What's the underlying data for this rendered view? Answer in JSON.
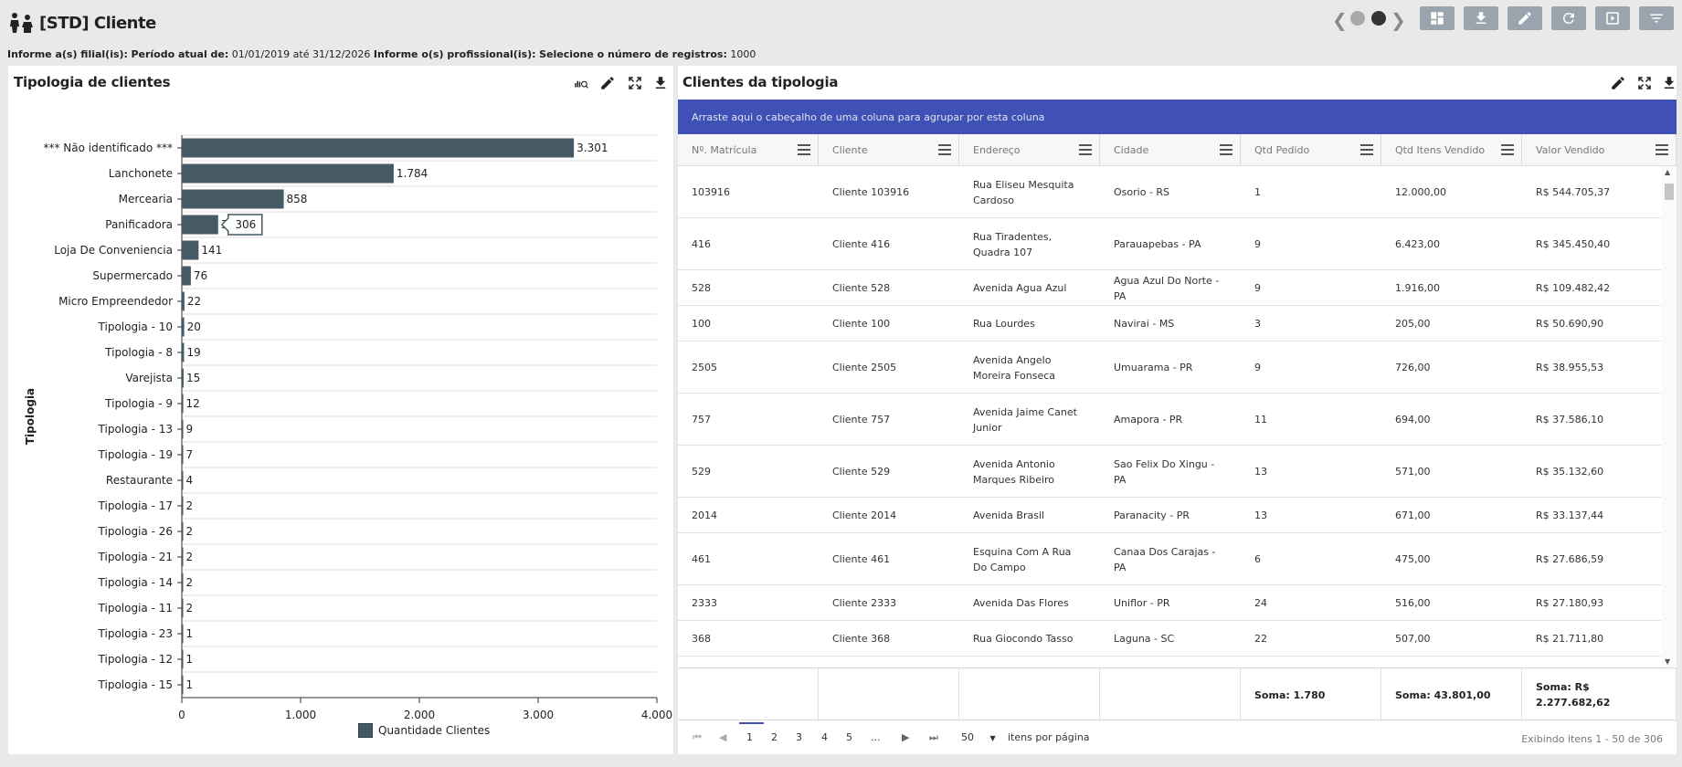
{
  "header": {
    "title": "[STD] Cliente"
  },
  "filters": {
    "branch_label": "Informe a(s) filial(is):",
    "period_label": "Período atual de:",
    "period_value": "01/01/2019 até 31/12/2026",
    "prof_label": "Informe o(s) profissional(is):",
    "records_label": "Selecione o número de registros:",
    "records_value": "1000"
  },
  "left_panel": {
    "title": "Tipologia de clientes",
    "legend_label": "Quantidade Clientes",
    "tooltip_value": "306"
  },
  "chart_data": {
    "type": "bar",
    "orientation": "horizontal",
    "ylabel": "Tipologia",
    "xlim": [
      0,
      4000
    ],
    "x_ticks": [
      "0",
      "1.000",
      "2.000",
      "3.000",
      "4.000"
    ],
    "x_tick_values": [
      0,
      1000,
      2000,
      3000,
      4000
    ],
    "categories": [
      "*** Não identificado ***",
      "Lanchonete",
      "Mercearia",
      "Panificadora",
      "Loja De Conveniencia",
      "Supermercado",
      "Micro Empreendedor",
      "Tipologia - 10",
      "Tipologia - 8",
      "Varejista",
      "Tipologia - 9",
      "Tipologia - 13",
      "Tipologia - 19",
      "Restaurante",
      "Tipologia - 17",
      "Tipologia - 26",
      "Tipologia - 21",
      "Tipologia - 14",
      "Tipologia - 11",
      "Tipologia - 23",
      "Tipologia - 12",
      "Tipologia - 15"
    ],
    "values": [
      3301,
      1784,
      858,
      306,
      141,
      76,
      22,
      20,
      19,
      15,
      12,
      9,
      7,
      4,
      2,
      2,
      2,
      2,
      2,
      1,
      1,
      1
    ],
    "labels": [
      "3.301",
      "1.784",
      "858",
      "306",
      "141",
      "76",
      "22",
      "20",
      "19",
      "15",
      "12",
      "9",
      "7",
      "4",
      "2",
      "2",
      "2",
      "2",
      "2",
      "1",
      "1",
      "1"
    ],
    "series": [
      {
        "name": "Quantidade Clientes",
        "color": "#455a64"
      }
    ],
    "grid": true,
    "legend": "bottom-center"
  },
  "right_panel": {
    "title": "Clientes da tipologia",
    "group_hint": "Arraste aqui o cabeçalho de uma coluna para agrupar por esta coluna",
    "columns": [
      "Nº. Matrícula",
      "Cliente",
      "Endereço",
      "Cidade",
      "Qtd Pedido",
      "Qtd Itens Vendido",
      "Valor Vendido"
    ],
    "rows": [
      [
        "103916",
        "Cliente 103916",
        "Rua Eliseu Mesquita Cardoso",
        "Osorio - RS",
        "1",
        "12.000,00",
        "R$ 544.705,37"
      ],
      [
        "416",
        "Cliente 416",
        "Rua Tiradentes, Quadra 107",
        "Parauapebas - PA",
        "9",
        "6.423,00",
        "R$ 345.450,40"
      ],
      [
        "528",
        "Cliente 528",
        "Avenida Agua Azul",
        "Agua Azul Do Norte - PA",
        "9",
        "1.916,00",
        "R$ 109.482,42"
      ],
      [
        "100",
        "Cliente 100",
        "Rua Lourdes",
        "Navirai - MS",
        "3",
        "205,00",
        "R$ 50.690,90"
      ],
      [
        "2505",
        "Cliente 2505",
        "Avenida Angelo Moreira Fonseca",
        "Umuarama - PR",
        "9",
        "726,00",
        "R$ 38.955,53"
      ],
      [
        "757",
        "Cliente 757",
        "Avenida Jaime Canet Junior",
        "Amapora - PR",
        "11",
        "694,00",
        "R$ 37.586,10"
      ],
      [
        "529",
        "Cliente 529",
        "Avenida Antonio Marques Ribeiro",
        "Sao Felix Do Xingu - PA",
        "13",
        "571,00",
        "R$ 35.132,60"
      ],
      [
        "2014",
        "Cliente 2014",
        "Avenida Brasil",
        "Paranacity - PR",
        "13",
        "671,00",
        "R$ 33.137,44"
      ],
      [
        "461",
        "Cliente 461",
        "Esquina Com A Rua Do Campo",
        "Canaa Dos Carajas - PA",
        "6",
        "475,00",
        "R$ 27.686,59"
      ],
      [
        "2333",
        "Cliente 2333",
        "Avenida Das Flores",
        "Uniflor - PR",
        "24",
        "516,00",
        "R$ 27.180,93"
      ],
      [
        "368",
        "Cliente 368",
        "Rua Giocondo Tasso",
        "Laguna - SC",
        "22",
        "507,00",
        "R$ 21.711,80"
      ]
    ],
    "totals": {
      "qtd_pedido": "Soma: 1.780",
      "qtd_itens": "Soma: 43.801,00",
      "valor": "Soma: R$ 2.277.682,62"
    },
    "pager": {
      "pages": [
        "1",
        "2",
        "3",
        "4",
        "5",
        "..."
      ],
      "page_size": "50",
      "page_size_label": "itens por página",
      "info": "Exibindo itens 1 - 50 de 306"
    }
  },
  "colors": {
    "bar": "#455a64",
    "group_bar": "#3f51b5",
    "toolbar_button": "#9aa4ae"
  }
}
